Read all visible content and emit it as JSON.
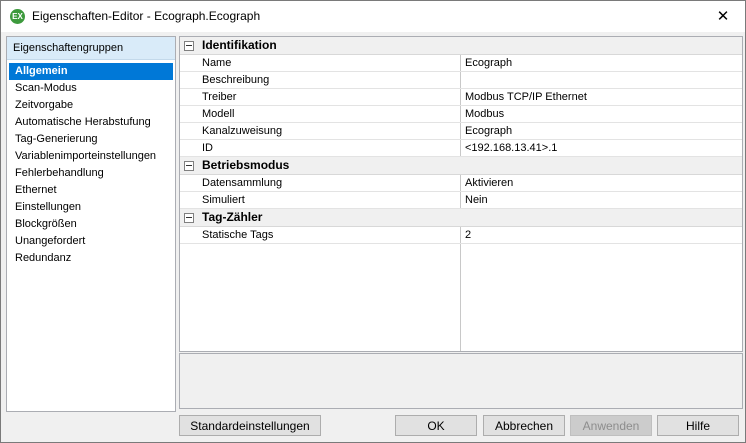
{
  "window": {
    "title": "Eigenschaften-Editor - Ecograph.Ecograph",
    "icon_text": "EX",
    "close_glyph": "✕"
  },
  "left_panel": {
    "header": "Eigenschaftengruppen",
    "items": [
      "Allgemein",
      "Scan-Modus",
      "Zeitvorgabe",
      "Automatische Herabstufung",
      "Tag-Generierung",
      "Variablenimporteinstellungen",
      "Fehlerbehandlung",
      "Ethernet",
      "Einstellungen",
      "Blockgrößen",
      "Unangefordert",
      "Redundanz"
    ],
    "selected_index": 0
  },
  "grid": {
    "categories": [
      {
        "label": "Identifikation",
        "rows": [
          {
            "name": "Name",
            "value": "Ecograph"
          },
          {
            "name": "Beschreibung",
            "value": ""
          },
          {
            "name": "Treiber",
            "value": "Modbus TCP/IP Ethernet"
          },
          {
            "name": "Modell",
            "value": "Modbus"
          },
          {
            "name": "Kanalzuweisung",
            "value": "Ecograph"
          },
          {
            "name": "ID",
            "value": "<192.168.13.41>.1"
          }
        ]
      },
      {
        "label": "Betriebsmodus",
        "rows": [
          {
            "name": "Datensammlung",
            "value": "Aktivieren"
          },
          {
            "name": "Simuliert",
            "value": "Nein"
          }
        ]
      },
      {
        "label": "Tag-Zähler",
        "rows": [
          {
            "name": "Statische Tags",
            "value": "2"
          }
        ]
      }
    ]
  },
  "buttons": {
    "defaults": "Standardeinstellungen",
    "ok": "OK",
    "cancel": "Abbrechen",
    "apply": "Anwenden",
    "help": "Hilfe"
  }
}
